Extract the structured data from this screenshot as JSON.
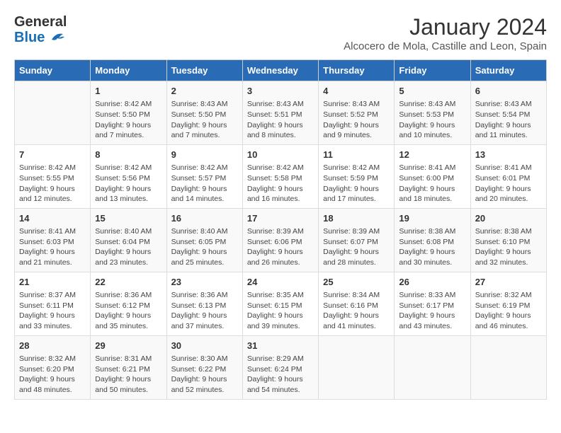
{
  "header": {
    "logo_general": "General",
    "logo_blue": "Blue",
    "title": "January 2024",
    "subtitle": "Alcocero de Mola, Castille and Leon, Spain"
  },
  "calendar": {
    "days_of_week": [
      "Sunday",
      "Monday",
      "Tuesday",
      "Wednesday",
      "Thursday",
      "Friday",
      "Saturday"
    ],
    "weeks": [
      [
        {
          "day": "",
          "content": ""
        },
        {
          "day": "1",
          "content": "Sunrise: 8:42 AM\nSunset: 5:50 PM\nDaylight: 9 hours\nand 7 minutes."
        },
        {
          "day": "2",
          "content": "Sunrise: 8:43 AM\nSunset: 5:50 PM\nDaylight: 9 hours\nand 7 minutes."
        },
        {
          "day": "3",
          "content": "Sunrise: 8:43 AM\nSunset: 5:51 PM\nDaylight: 9 hours\nand 8 minutes."
        },
        {
          "day": "4",
          "content": "Sunrise: 8:43 AM\nSunset: 5:52 PM\nDaylight: 9 hours\nand 9 minutes."
        },
        {
          "day": "5",
          "content": "Sunrise: 8:43 AM\nSunset: 5:53 PM\nDaylight: 9 hours\nand 10 minutes."
        },
        {
          "day": "6",
          "content": "Sunrise: 8:43 AM\nSunset: 5:54 PM\nDaylight: 9 hours\nand 11 minutes."
        }
      ],
      [
        {
          "day": "7",
          "content": "Sunrise: 8:42 AM\nSunset: 5:55 PM\nDaylight: 9 hours\nand 12 minutes."
        },
        {
          "day": "8",
          "content": "Sunrise: 8:42 AM\nSunset: 5:56 PM\nDaylight: 9 hours\nand 13 minutes."
        },
        {
          "day": "9",
          "content": "Sunrise: 8:42 AM\nSunset: 5:57 PM\nDaylight: 9 hours\nand 14 minutes."
        },
        {
          "day": "10",
          "content": "Sunrise: 8:42 AM\nSunset: 5:58 PM\nDaylight: 9 hours\nand 16 minutes."
        },
        {
          "day": "11",
          "content": "Sunrise: 8:42 AM\nSunset: 5:59 PM\nDaylight: 9 hours\nand 17 minutes."
        },
        {
          "day": "12",
          "content": "Sunrise: 8:41 AM\nSunset: 6:00 PM\nDaylight: 9 hours\nand 18 minutes."
        },
        {
          "day": "13",
          "content": "Sunrise: 8:41 AM\nSunset: 6:01 PM\nDaylight: 9 hours\nand 20 minutes."
        }
      ],
      [
        {
          "day": "14",
          "content": "Sunrise: 8:41 AM\nSunset: 6:03 PM\nDaylight: 9 hours\nand 21 minutes."
        },
        {
          "day": "15",
          "content": "Sunrise: 8:40 AM\nSunset: 6:04 PM\nDaylight: 9 hours\nand 23 minutes."
        },
        {
          "day": "16",
          "content": "Sunrise: 8:40 AM\nSunset: 6:05 PM\nDaylight: 9 hours\nand 25 minutes."
        },
        {
          "day": "17",
          "content": "Sunrise: 8:39 AM\nSunset: 6:06 PM\nDaylight: 9 hours\nand 26 minutes."
        },
        {
          "day": "18",
          "content": "Sunrise: 8:39 AM\nSunset: 6:07 PM\nDaylight: 9 hours\nand 28 minutes."
        },
        {
          "day": "19",
          "content": "Sunrise: 8:38 AM\nSunset: 6:08 PM\nDaylight: 9 hours\nand 30 minutes."
        },
        {
          "day": "20",
          "content": "Sunrise: 8:38 AM\nSunset: 6:10 PM\nDaylight: 9 hours\nand 32 minutes."
        }
      ],
      [
        {
          "day": "21",
          "content": "Sunrise: 8:37 AM\nSunset: 6:11 PM\nDaylight: 9 hours\nand 33 minutes."
        },
        {
          "day": "22",
          "content": "Sunrise: 8:36 AM\nSunset: 6:12 PM\nDaylight: 9 hours\nand 35 minutes."
        },
        {
          "day": "23",
          "content": "Sunrise: 8:36 AM\nSunset: 6:13 PM\nDaylight: 9 hours\nand 37 minutes."
        },
        {
          "day": "24",
          "content": "Sunrise: 8:35 AM\nSunset: 6:15 PM\nDaylight: 9 hours\nand 39 minutes."
        },
        {
          "day": "25",
          "content": "Sunrise: 8:34 AM\nSunset: 6:16 PM\nDaylight: 9 hours\nand 41 minutes."
        },
        {
          "day": "26",
          "content": "Sunrise: 8:33 AM\nSunset: 6:17 PM\nDaylight: 9 hours\nand 43 minutes."
        },
        {
          "day": "27",
          "content": "Sunrise: 8:32 AM\nSunset: 6:19 PM\nDaylight: 9 hours\nand 46 minutes."
        }
      ],
      [
        {
          "day": "28",
          "content": "Sunrise: 8:32 AM\nSunset: 6:20 PM\nDaylight: 9 hours\nand 48 minutes."
        },
        {
          "day": "29",
          "content": "Sunrise: 8:31 AM\nSunset: 6:21 PM\nDaylight: 9 hours\nand 50 minutes."
        },
        {
          "day": "30",
          "content": "Sunrise: 8:30 AM\nSunset: 6:22 PM\nDaylight: 9 hours\nand 52 minutes."
        },
        {
          "day": "31",
          "content": "Sunrise: 8:29 AM\nSunset: 6:24 PM\nDaylight: 9 hours\nand 54 minutes."
        },
        {
          "day": "",
          "content": ""
        },
        {
          "day": "",
          "content": ""
        },
        {
          "day": "",
          "content": ""
        }
      ]
    ]
  }
}
